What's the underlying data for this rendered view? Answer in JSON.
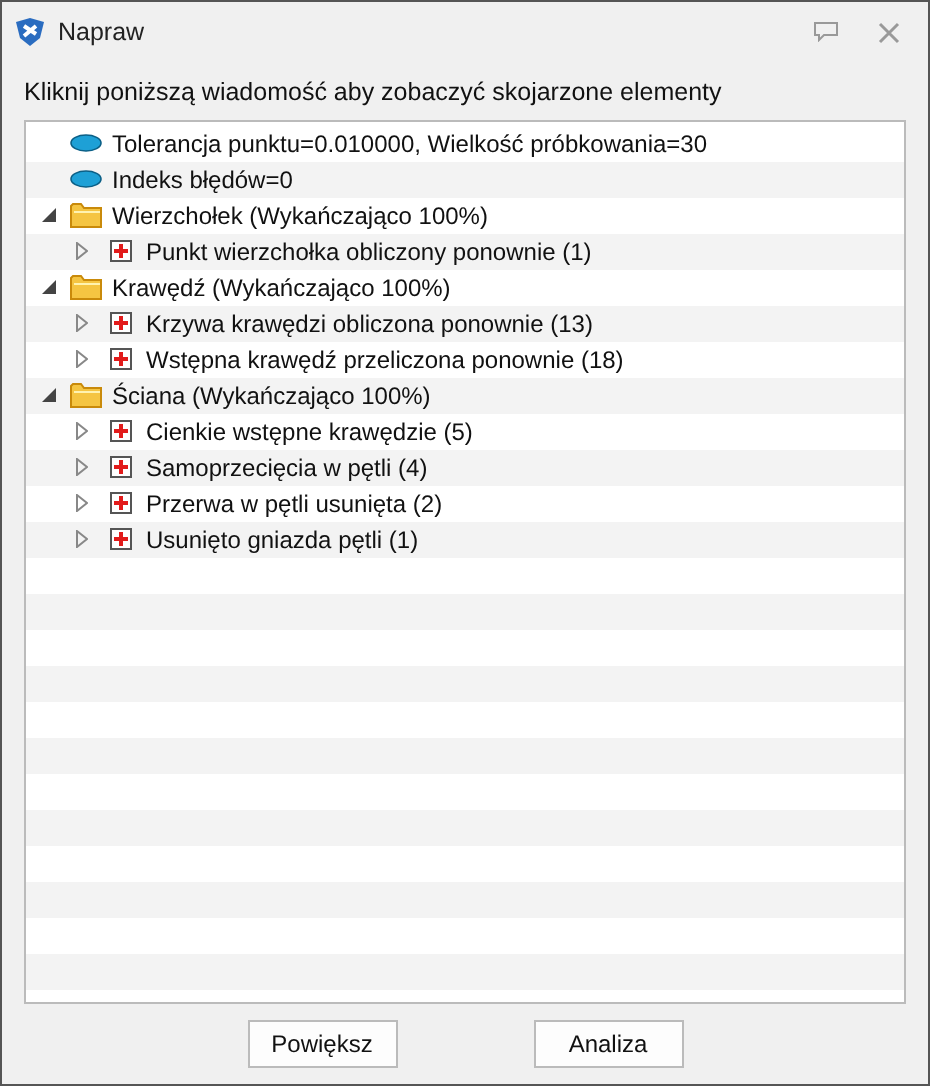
{
  "window": {
    "title": "Napraw"
  },
  "instruction": "Kliknij poniższą wiadomość aby zobaczyć skojarzone elementy",
  "tree": [
    {
      "kind": "info",
      "label": "Tolerancja punktu=0.010000, Wielkość próbkowania=30"
    },
    {
      "kind": "info",
      "label": "Indeks błędów=0"
    },
    {
      "kind": "group",
      "label": "Wierzchołek (Wykańczająco 100%)",
      "expanded": true,
      "children": [
        {
          "kind": "error",
          "label": "Punkt wierzchołka obliczony ponownie (1)",
          "expanded": false
        }
      ]
    },
    {
      "kind": "group",
      "label": "Krawędź (Wykańczająco 100%)",
      "expanded": true,
      "children": [
        {
          "kind": "error",
          "label": "Krzywa krawędzi obliczona ponownie (13)",
          "expanded": false
        },
        {
          "kind": "error",
          "label": "Wstępna krawędź przeliczona ponownie (18)",
          "expanded": false
        }
      ]
    },
    {
      "kind": "group",
      "label": "Ściana (Wykańczająco 100%)",
      "expanded": true,
      "children": [
        {
          "kind": "error",
          "label": "Cienkie wstępne krawędzie (5)",
          "expanded": false
        },
        {
          "kind": "error",
          "label": "Samoprzecięcia w pętli (4)",
          "expanded": false
        },
        {
          "kind": "error",
          "label": "Przerwa w pętli usunięta (2)",
          "expanded": false
        },
        {
          "kind": "error",
          "label": "Usunięto gniazda pętli (1)",
          "expanded": false
        }
      ]
    }
  ],
  "buttons": [
    "Powiększ",
    "Analiza"
  ]
}
